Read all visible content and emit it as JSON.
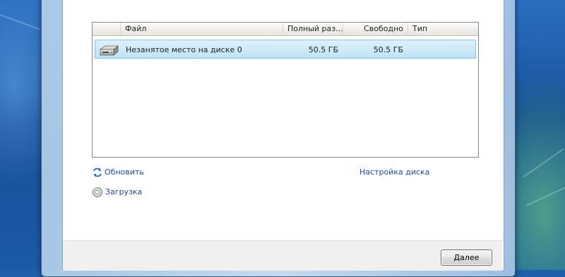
{
  "listview": {
    "columns": [
      "Файл",
      "Полный раз...",
      "Свободно",
      "Тип"
    ],
    "rows": [
      {
        "name": "Незанятое место на диске 0",
        "total": "50.5 ГБ",
        "free": "50.5 ГБ",
        "type": "",
        "icon": "hard-disk-icon"
      }
    ]
  },
  "links": {
    "refresh": "Обновить",
    "load": "Загрузка",
    "disk_setup": "Настройка диска"
  },
  "buttons": {
    "next": "Далее"
  }
}
